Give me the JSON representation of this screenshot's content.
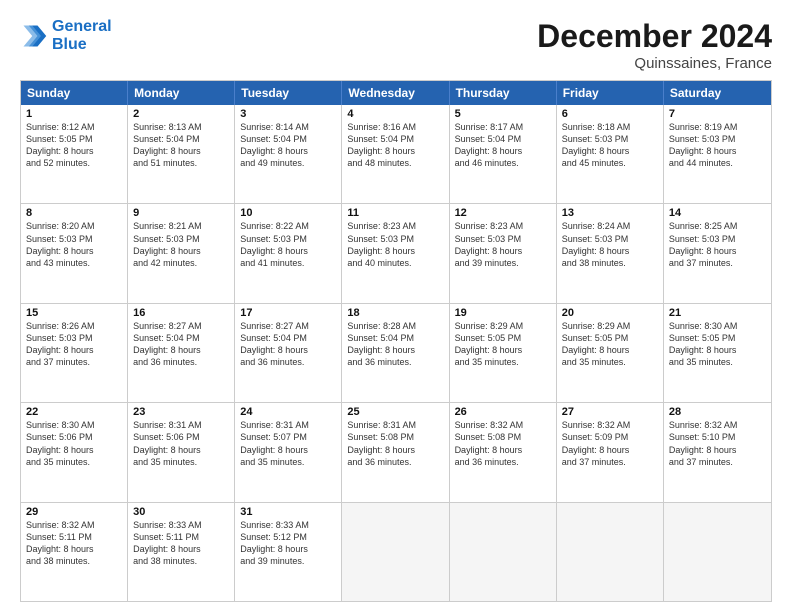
{
  "header": {
    "logo_line1": "General",
    "logo_line2": "Blue",
    "title": "December 2024",
    "subtitle": "Quinssaines, France"
  },
  "days_of_week": [
    "Sunday",
    "Monday",
    "Tuesday",
    "Wednesday",
    "Thursday",
    "Friday",
    "Saturday"
  ],
  "weeks": [
    [
      {
        "day": "1",
        "lines": [
          "Sunrise: 8:12 AM",
          "Sunset: 5:05 PM",
          "Daylight: 8 hours",
          "and 52 minutes."
        ]
      },
      {
        "day": "2",
        "lines": [
          "Sunrise: 8:13 AM",
          "Sunset: 5:04 PM",
          "Daylight: 8 hours",
          "and 51 minutes."
        ]
      },
      {
        "day": "3",
        "lines": [
          "Sunrise: 8:14 AM",
          "Sunset: 5:04 PM",
          "Daylight: 8 hours",
          "and 49 minutes."
        ]
      },
      {
        "day": "4",
        "lines": [
          "Sunrise: 8:16 AM",
          "Sunset: 5:04 PM",
          "Daylight: 8 hours",
          "and 48 minutes."
        ]
      },
      {
        "day": "5",
        "lines": [
          "Sunrise: 8:17 AM",
          "Sunset: 5:04 PM",
          "Daylight: 8 hours",
          "and 46 minutes."
        ]
      },
      {
        "day": "6",
        "lines": [
          "Sunrise: 8:18 AM",
          "Sunset: 5:03 PM",
          "Daylight: 8 hours",
          "and 45 minutes."
        ]
      },
      {
        "day": "7",
        "lines": [
          "Sunrise: 8:19 AM",
          "Sunset: 5:03 PM",
          "Daylight: 8 hours",
          "and 44 minutes."
        ]
      }
    ],
    [
      {
        "day": "8",
        "lines": [
          "Sunrise: 8:20 AM",
          "Sunset: 5:03 PM",
          "Daylight: 8 hours",
          "and 43 minutes."
        ]
      },
      {
        "day": "9",
        "lines": [
          "Sunrise: 8:21 AM",
          "Sunset: 5:03 PM",
          "Daylight: 8 hours",
          "and 42 minutes."
        ]
      },
      {
        "day": "10",
        "lines": [
          "Sunrise: 8:22 AM",
          "Sunset: 5:03 PM",
          "Daylight: 8 hours",
          "and 41 minutes."
        ]
      },
      {
        "day": "11",
        "lines": [
          "Sunrise: 8:23 AM",
          "Sunset: 5:03 PM",
          "Daylight: 8 hours",
          "and 40 minutes."
        ]
      },
      {
        "day": "12",
        "lines": [
          "Sunrise: 8:23 AM",
          "Sunset: 5:03 PM",
          "Daylight: 8 hours",
          "and 39 minutes."
        ]
      },
      {
        "day": "13",
        "lines": [
          "Sunrise: 8:24 AM",
          "Sunset: 5:03 PM",
          "Daylight: 8 hours",
          "and 38 minutes."
        ]
      },
      {
        "day": "14",
        "lines": [
          "Sunrise: 8:25 AM",
          "Sunset: 5:03 PM",
          "Daylight: 8 hours",
          "and 37 minutes."
        ]
      }
    ],
    [
      {
        "day": "15",
        "lines": [
          "Sunrise: 8:26 AM",
          "Sunset: 5:03 PM",
          "Daylight: 8 hours",
          "and 37 minutes."
        ]
      },
      {
        "day": "16",
        "lines": [
          "Sunrise: 8:27 AM",
          "Sunset: 5:04 PM",
          "Daylight: 8 hours",
          "and 36 minutes."
        ]
      },
      {
        "day": "17",
        "lines": [
          "Sunrise: 8:27 AM",
          "Sunset: 5:04 PM",
          "Daylight: 8 hours",
          "and 36 minutes."
        ]
      },
      {
        "day": "18",
        "lines": [
          "Sunrise: 8:28 AM",
          "Sunset: 5:04 PM",
          "Daylight: 8 hours",
          "and 36 minutes."
        ]
      },
      {
        "day": "19",
        "lines": [
          "Sunrise: 8:29 AM",
          "Sunset: 5:05 PM",
          "Daylight: 8 hours",
          "and 35 minutes."
        ]
      },
      {
        "day": "20",
        "lines": [
          "Sunrise: 8:29 AM",
          "Sunset: 5:05 PM",
          "Daylight: 8 hours",
          "and 35 minutes."
        ]
      },
      {
        "day": "21",
        "lines": [
          "Sunrise: 8:30 AM",
          "Sunset: 5:05 PM",
          "Daylight: 8 hours",
          "and 35 minutes."
        ]
      }
    ],
    [
      {
        "day": "22",
        "lines": [
          "Sunrise: 8:30 AM",
          "Sunset: 5:06 PM",
          "Daylight: 8 hours",
          "and 35 minutes."
        ]
      },
      {
        "day": "23",
        "lines": [
          "Sunrise: 8:31 AM",
          "Sunset: 5:06 PM",
          "Daylight: 8 hours",
          "and 35 minutes."
        ]
      },
      {
        "day": "24",
        "lines": [
          "Sunrise: 8:31 AM",
          "Sunset: 5:07 PM",
          "Daylight: 8 hours",
          "and 35 minutes."
        ]
      },
      {
        "day": "25",
        "lines": [
          "Sunrise: 8:31 AM",
          "Sunset: 5:08 PM",
          "Daylight: 8 hours",
          "and 36 minutes."
        ]
      },
      {
        "day": "26",
        "lines": [
          "Sunrise: 8:32 AM",
          "Sunset: 5:08 PM",
          "Daylight: 8 hours",
          "and 36 minutes."
        ]
      },
      {
        "day": "27",
        "lines": [
          "Sunrise: 8:32 AM",
          "Sunset: 5:09 PM",
          "Daylight: 8 hours",
          "and 37 minutes."
        ]
      },
      {
        "day": "28",
        "lines": [
          "Sunrise: 8:32 AM",
          "Sunset: 5:10 PM",
          "Daylight: 8 hours",
          "and 37 minutes."
        ]
      }
    ],
    [
      {
        "day": "29",
        "lines": [
          "Sunrise: 8:32 AM",
          "Sunset: 5:11 PM",
          "Daylight: 8 hours",
          "and 38 minutes."
        ]
      },
      {
        "day": "30",
        "lines": [
          "Sunrise: 8:33 AM",
          "Sunset: 5:11 PM",
          "Daylight: 8 hours",
          "and 38 minutes."
        ]
      },
      {
        "day": "31",
        "lines": [
          "Sunrise: 8:33 AM",
          "Sunset: 5:12 PM",
          "Daylight: 8 hours",
          "and 39 minutes."
        ]
      },
      null,
      null,
      null,
      null
    ]
  ]
}
